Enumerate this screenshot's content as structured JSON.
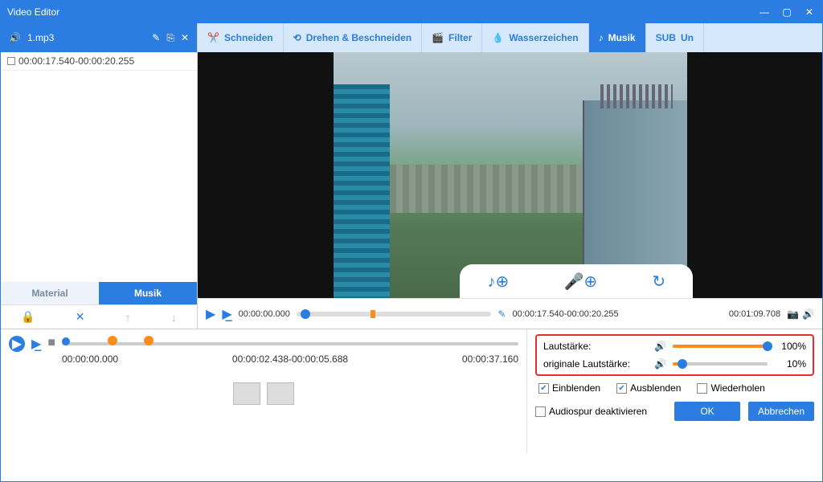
{
  "title": "Video Editor",
  "sidebar": {
    "file": "1.mp3",
    "clip": "00:00:17.540-00:00:20.255",
    "tabs": [
      "Material",
      "Musik"
    ]
  },
  "toolbar": [
    {
      "label": "Schneiden"
    },
    {
      "label": "Drehen & Beschneiden"
    },
    {
      "label": "Filter"
    },
    {
      "label": "Wasserzeichen"
    },
    {
      "label": "Musik"
    },
    {
      "label": "Un"
    }
  ],
  "track": {
    "start": "00:00:00.000",
    "sel": "00:00:17.540-00:00:20.255",
    "end": "00:01:09.708"
  },
  "timeline": {
    "t0": "00:00:00.000",
    "t1": "00:00:02.438-00:00:05.688",
    "t2": "00:00:37.160"
  },
  "volume": {
    "label1": "Lautstärke:",
    "val1": "100%",
    "pct1": 100,
    "label2": "originale Lautstärke:",
    "val2": "10%",
    "pct2": 10
  },
  "checks": {
    "fadein": "Einblenden",
    "fadeout": "Ausblenden",
    "repeat": "Wiederholen",
    "mute": "Audiospur deaktivieren"
  },
  "buttons": {
    "ok": "OK",
    "cancel": "Abbrechen"
  }
}
